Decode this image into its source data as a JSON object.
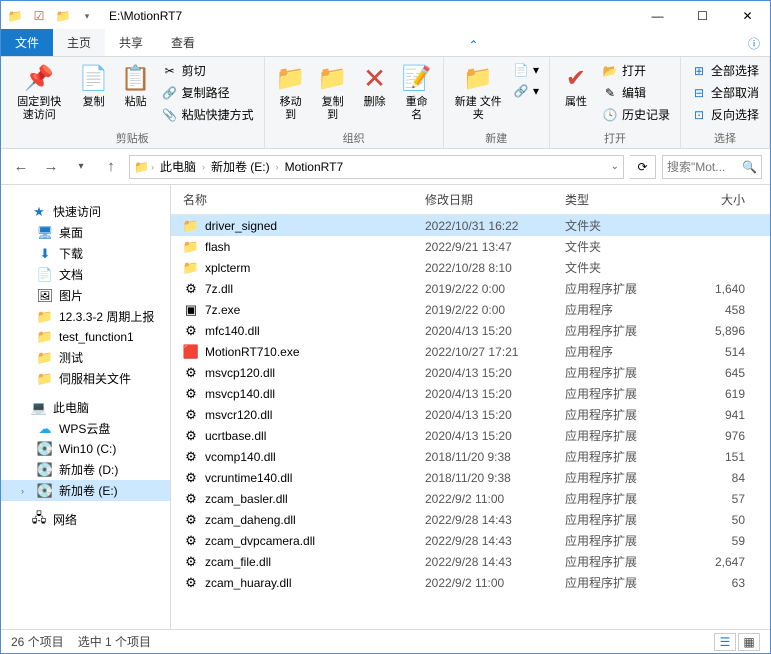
{
  "title": "E:\\MotionRT7",
  "tabs": {
    "file": "文件",
    "home": "主页",
    "share": "共享",
    "view": "查看"
  },
  "ribbon": {
    "pin": "固定到快\n速访问",
    "copy": "复制",
    "paste": "粘贴",
    "cut": "剪切",
    "copypath": "复制路径",
    "pasteshortcut": "粘贴快捷方式",
    "moveto": "移动到",
    "copyto": "复制到",
    "delete": "删除",
    "rename": "重命名",
    "newfolder": "新建\n文件夹",
    "properties": "属性",
    "open": "打开",
    "edit": "编辑",
    "history": "历史记录",
    "selectall": "全部选择",
    "selectnone": "全部取消",
    "invert": "反向选择",
    "g_clipboard": "剪贴板",
    "g_organize": "组织",
    "g_new": "新建",
    "g_open": "打开",
    "g_select": "选择"
  },
  "breadcrumb": {
    "thispc": "此电脑",
    "drive": "新加卷 (E:)",
    "folder": "MotionRT7"
  },
  "search_placeholder": "搜索\"Mot...",
  "sidebar": {
    "quick": "快速访问",
    "desktop": "桌面",
    "downloads": "下载",
    "documents": "文档",
    "pictures": "图片",
    "f1": "12.3.3-2 周期上报",
    "f2": "test_function1",
    "f3": "测试",
    "f4": "伺服相关文件",
    "thispc": "此电脑",
    "wps": "WPS云盘",
    "win10": "Win10 (C:)",
    "dd": "新加卷 (D:)",
    "de": "新加卷 (E:)",
    "network": "网络"
  },
  "columns": {
    "name": "名称",
    "date": "修改日期",
    "type": "类型",
    "size": "大小"
  },
  "types": {
    "folder": "文件夹",
    "ext": "应用程序扩展",
    "exe": "应用程序"
  },
  "files": [
    {
      "name": "driver_signed",
      "date": "2022/10/31 16:22",
      "type": "folder",
      "size": "",
      "icon": "folder",
      "selected": true
    },
    {
      "name": "flash",
      "date": "2022/9/21 13:47",
      "type": "folder",
      "size": "",
      "icon": "folder"
    },
    {
      "name": "xplcterm",
      "date": "2022/10/28 8:10",
      "type": "folder",
      "size": "",
      "icon": "folder"
    },
    {
      "name": "7z.dll",
      "date": "2019/2/22 0:00",
      "type": "ext",
      "size": "1,640",
      "icon": "dll"
    },
    {
      "name": "7z.exe",
      "date": "2019/2/22 0:00",
      "type": "exe",
      "size": "458",
      "icon": "exe"
    },
    {
      "name": "mfc140.dll",
      "date": "2020/4/13 15:20",
      "type": "ext",
      "size": "5,896",
      "icon": "dll"
    },
    {
      "name": "MotionRT710.exe",
      "date": "2022/10/27 17:21",
      "type": "exe",
      "size": "514",
      "icon": "exe2"
    },
    {
      "name": "msvcp120.dll",
      "date": "2020/4/13 15:20",
      "type": "ext",
      "size": "645",
      "icon": "dll"
    },
    {
      "name": "msvcp140.dll",
      "date": "2020/4/13 15:20",
      "type": "ext",
      "size": "619",
      "icon": "dll"
    },
    {
      "name": "msvcr120.dll",
      "date": "2020/4/13 15:20",
      "type": "ext",
      "size": "941",
      "icon": "dll"
    },
    {
      "name": "ucrtbase.dll",
      "date": "2020/4/13 15:20",
      "type": "ext",
      "size": "976",
      "icon": "dll"
    },
    {
      "name": "vcomp140.dll",
      "date": "2018/11/20 9:38",
      "type": "ext",
      "size": "151",
      "icon": "dll"
    },
    {
      "name": "vcruntime140.dll",
      "date": "2018/11/20 9:38",
      "type": "ext",
      "size": "84",
      "icon": "dll"
    },
    {
      "name": "zcam_basler.dll",
      "date": "2022/9/2 11:00",
      "type": "ext",
      "size": "57",
      "icon": "dll"
    },
    {
      "name": "zcam_daheng.dll",
      "date": "2022/9/28 14:43",
      "type": "ext",
      "size": "50",
      "icon": "dll"
    },
    {
      "name": "zcam_dvpcamera.dll",
      "date": "2022/9/28 14:43",
      "type": "ext",
      "size": "59",
      "icon": "dll"
    },
    {
      "name": "zcam_file.dll",
      "date": "2022/9/28 14:43",
      "type": "ext",
      "size": "2,647",
      "icon": "dll"
    },
    {
      "name": "zcam_huaray.dll",
      "date": "2022/9/2 11:00",
      "type": "ext",
      "size": "63",
      "icon": "dll"
    }
  ],
  "status": {
    "count": "26 个项目",
    "selected": "选中 1 个项目"
  }
}
